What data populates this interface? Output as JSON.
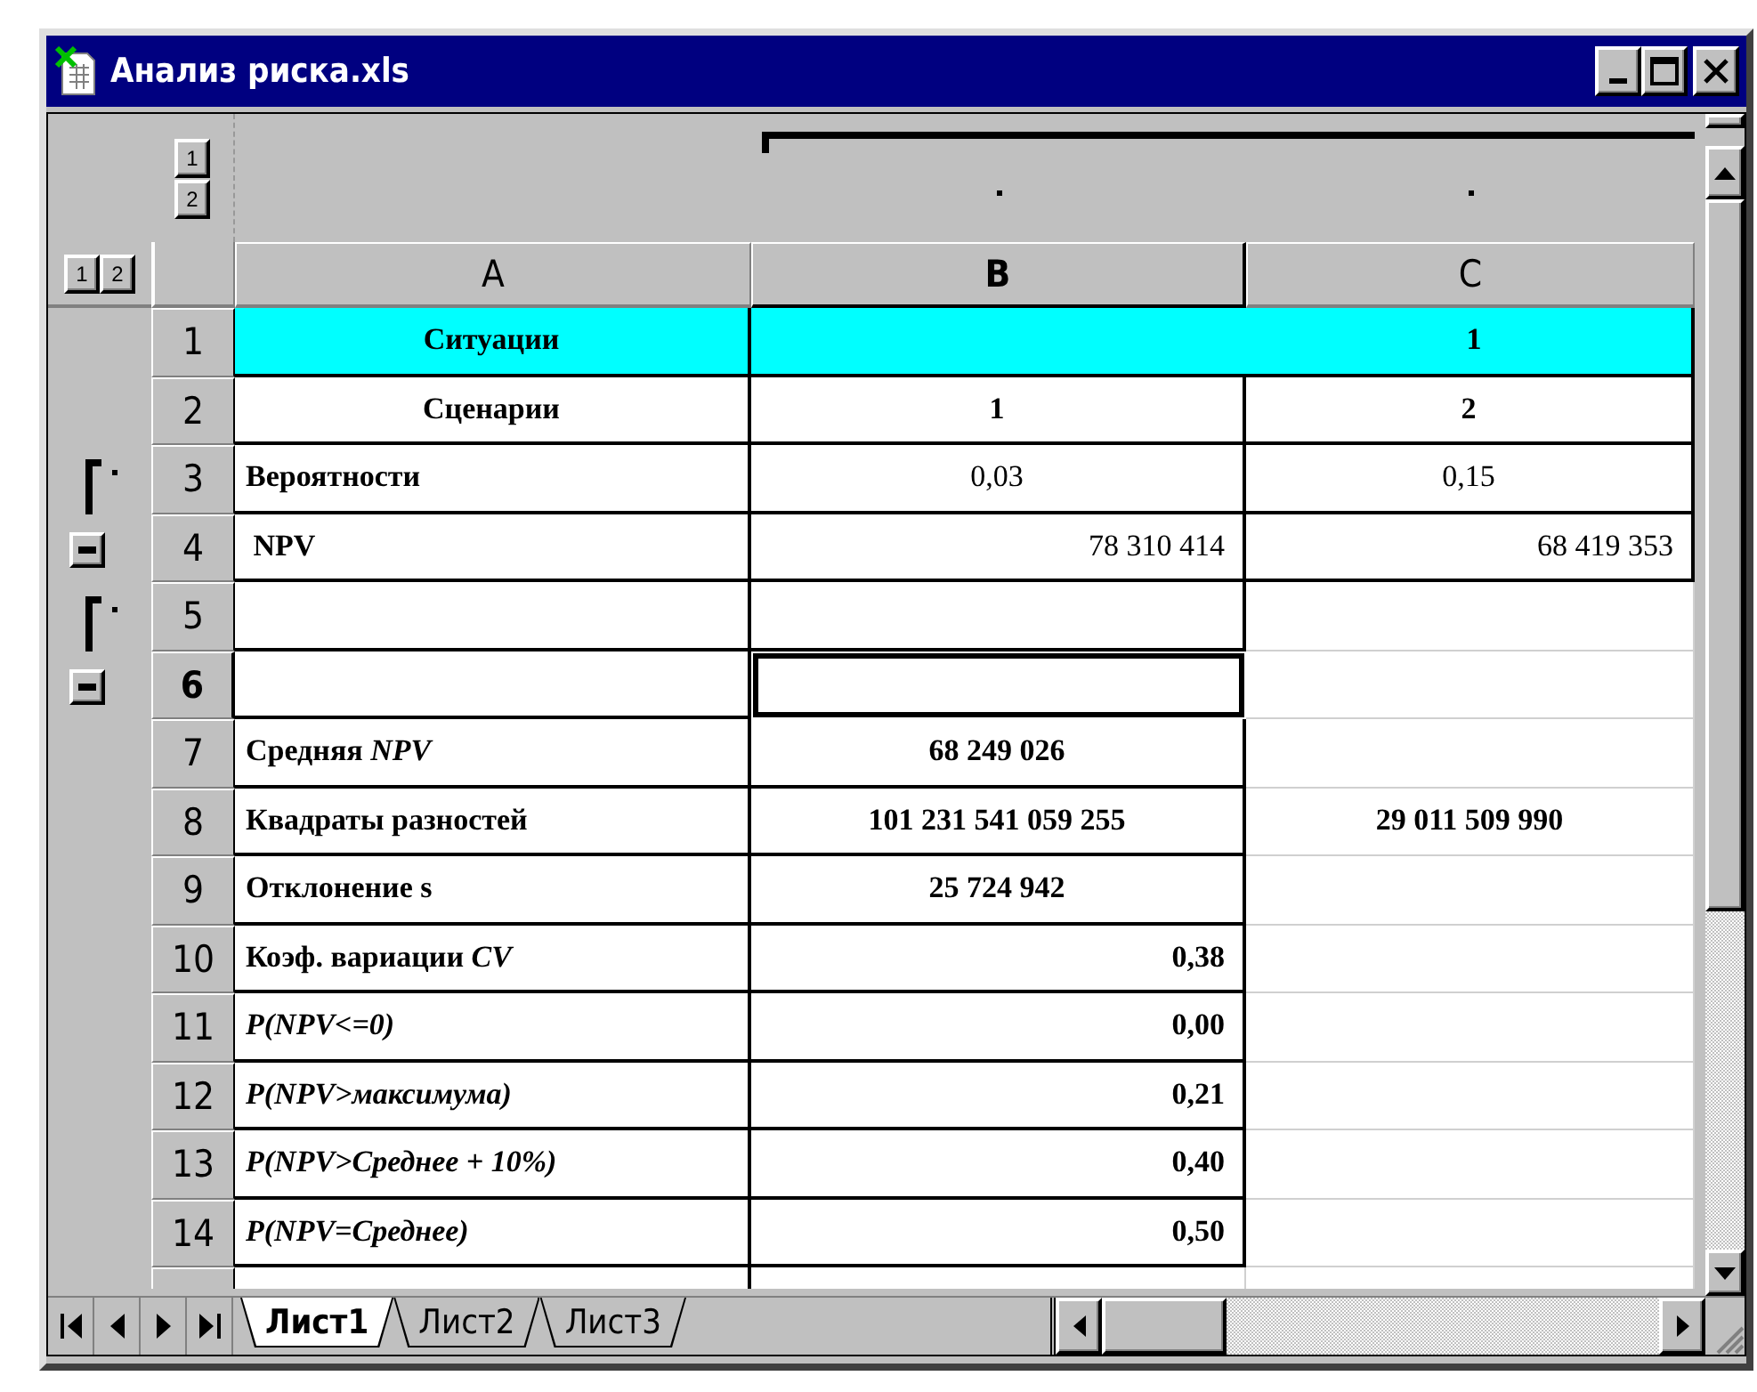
{
  "window": {
    "title": "Анализ риска.xls"
  },
  "outline_levels": {
    "columns": [
      "1",
      "2"
    ],
    "rows": [
      "1",
      "2"
    ]
  },
  "columns": [
    {
      "label": "A",
      "selected": false
    },
    {
      "label": "B",
      "selected": true
    },
    {
      "label": "C",
      "selected": false
    }
  ],
  "rows": [
    {
      "number": "1",
      "selected": false,
      "cells": [
        {
          "text": "Ситуации",
          "kind": "heading",
          "selected": false,
          "color": "#00ffff"
        },
        {
          "text": "1",
          "kind": "heading",
          "selected": false,
          "merged": true,
          "color": "#00ffff"
        }
      ]
    },
    {
      "number": "2",
      "selected": false,
      "cells": [
        {
          "text": "Сценарии",
          "kind": "heading",
          "selected": false
        },
        {
          "text": "1",
          "kind": "heading",
          "selected": false
        },
        {
          "text": "2",
          "kind": "heading",
          "selected": false
        }
      ]
    },
    {
      "number": "3",
      "selected": false,
      "kind": "bracket",
      "cells": [
        {
          "text": "Вероятности",
          "kind": "label",
          "selected": false
        },
        {
          "text": "0,03",
          "kind": "value",
          "selected": false
        },
        {
          "text": "0,15",
          "kind": "value",
          "selected": false
        }
      ]
    },
    {
      "number": "4",
      "selected": false,
      "kind": "toggle",
      "expanded": true,
      "cells": [
        {
          "text": " NPV",
          "kind": "label",
          "selected": false
        },
        {
          "text": "78 310 414",
          "kind": "amount",
          "selected": false
        },
        {
          "text": "68 419 353",
          "kind": "amount",
          "selected": false
        }
      ]
    },
    {
      "number": "5",
      "selected": false,
      "kind": "bracket",
      "cells": [
        {
          "selected": false
        },
        {
          "selected": false
        },
        {
          "selected": false
        }
      ]
    },
    {
      "number": "6",
      "selected": true,
      "kind": "toggle",
      "expanded": true,
      "cells": [
        {
          "selected": false
        },
        {
          "selected": true
        },
        {
          "selected": false
        }
      ]
    },
    {
      "number": "7",
      "selected": false,
      "cells": [
        {
          "text": "Средняя *NPV*",
          "kind": "label",
          "selected": false
        },
        {
          "text": "68 249 026",
          "kind": "heading",
          "selected": false
        },
        {
          "selected": false
        }
      ]
    },
    {
      "number": "8",
      "selected": false,
      "cells": [
        {
          "text": "Квадраты разностей",
          "kind": "label",
          "selected": false
        },
        {
          "text": "101 231 541 059 255",
          "kind": "heading",
          "selected": false
        },
        {
          "text": "29 011 509 990",
          "kind": "heading",
          "selected": false
        }
      ]
    },
    {
      "number": "9",
      "selected": false,
      "cells": [
        {
          "text": "Отклонение s",
          "kind": "label",
          "selected": false
        },
        {
          "text": "25 724 942",
          "kind": "heading",
          "selected": false
        },
        {
          "selected": false
        }
      ]
    },
    {
      "number": "10",
      "selected": false,
      "cells": [
        {
          "text": "Коэф. вариации *CV*",
          "kind": "label",
          "selected": false
        },
        {
          "text": "0,38",
          "kind": "result",
          "selected": false
        },
        {
          "selected": false
        }
      ]
    },
    {
      "number": "11",
      "selected": false,
      "cells": [
        {
          "text": "P(NPV<=0)",
          "kind": "formula",
          "selected": false
        },
        {
          "text": "0,00",
          "kind": "result",
          "selected": false
        },
        {
          "selected": false
        }
      ]
    },
    {
      "number": "12",
      "selected": false,
      "cells": [
        {
          "text": "P(NPV>максимума)",
          "kind": "formula",
          "selected": false
        },
        {
          "text": "0,21",
          "kind": "result",
          "selected": false
        },
        {
          "selected": false
        }
      ]
    },
    {
      "number": "13",
      "selected": false,
      "cells": [
        {
          "text": "P(NPV>Среднее + 10%)",
          "kind": "formula",
          "selected": false
        },
        {
          "text": "0,40",
          "kind": "result",
          "selected": false
        },
        {
          "selected": false
        }
      ]
    },
    {
      "number": "14",
      "selected": false,
      "cells": [
        {
          "text": "P(NPV=Среднее)",
          "kind": "formula",
          "selected": false
        },
        {
          "text": "0,50",
          "kind": "result",
          "selected": false
        },
        {
          "selected": false
        }
      ]
    }
  ],
  "tabs": [
    {
      "label": "Лист1",
      "selected": true
    },
    {
      "label": "Лист2",
      "selected": false
    },
    {
      "label": "Лист3",
      "selected": false
    }
  ]
}
